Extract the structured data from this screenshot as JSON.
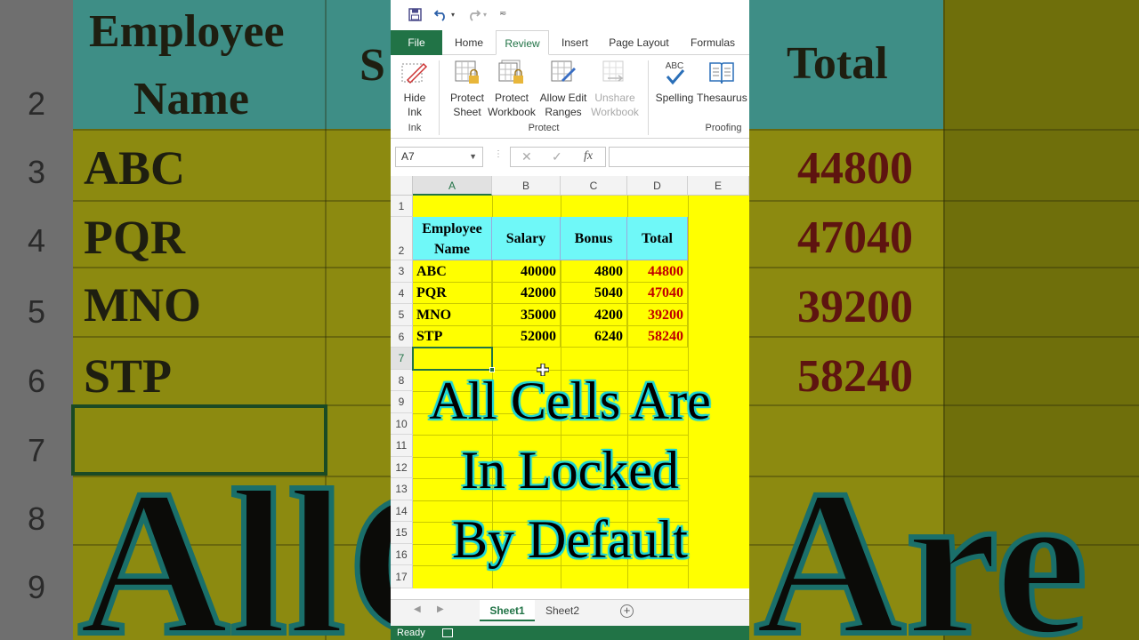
{
  "quick_access": {
    "save_icon": "save-icon",
    "undo_icon": "undo-icon",
    "redo_icon": "redo-icon",
    "customize_icon": "customize-icon"
  },
  "tabs": [
    "File",
    "Home",
    "Review",
    "Insert",
    "Page Layout",
    "Formulas"
  ],
  "active_tab": "Review",
  "ribbon": {
    "hide_ink": "Hide\nInk",
    "ink_group": "Ink",
    "protect_sheet": "Protect\nSheet",
    "protect_workbook": "Protect\nWorkbook",
    "allow_edit_ranges": "Allow Edit\nRanges",
    "unshare_workbook": "Unshare\nWorkbook",
    "protect_group": "Protect",
    "spelling": "Spelling",
    "thesaurus": "Thesaurus",
    "proofing_group": "Proofing",
    "abc_label": "ABC"
  },
  "formula_bar": {
    "name_box": "A7",
    "formula_value": ""
  },
  "columns": [
    "A",
    "B",
    "C",
    "D",
    "E"
  ],
  "rows": [
    "1",
    "2",
    "3",
    "4",
    "5",
    "6",
    "7",
    "8",
    "9",
    "10",
    "11",
    "12",
    "13",
    "14",
    "15",
    "16",
    "17"
  ],
  "table": {
    "headers": [
      "Employee\nName",
      "Salary",
      "Bonus",
      "Total"
    ],
    "data": [
      [
        "ABC",
        "40000",
        "4800",
        "44800"
      ],
      [
        "PQR",
        "42000",
        "5040",
        "47040"
      ],
      [
        "MNO",
        "35000",
        "4200",
        "39200"
      ],
      [
        "STP",
        "52000",
        "6240",
        "58240"
      ]
    ]
  },
  "overlay": {
    "line1": "All Cells Are",
    "line2": "In Locked",
    "line3": "By Default"
  },
  "sheet_tabs": [
    "Sheet1",
    "Sheet2"
  ],
  "active_sheet": "Sheet1",
  "status_text": "Ready",
  "background": {
    "row_numbers": [
      "2",
      "3",
      "4",
      "5",
      "6",
      "7",
      "8",
      "9"
    ],
    "header_employee": "Employee",
    "header_name": "Name",
    "header_partial": "S",
    "header_total": "Total",
    "names": [
      "ABC",
      "PQR",
      "MNO",
      "STP"
    ],
    "totals": [
      "44800",
      "47040",
      "39200",
      "58240"
    ],
    "big_left": "All",
    "big_mid": "C",
    "big_right": "Are"
  },
  "colors": {
    "excel_green": "#217346",
    "sheet_yellow": "#ffff00",
    "header_cyan": "#6ff8f8",
    "total_red": "#c00000"
  }
}
